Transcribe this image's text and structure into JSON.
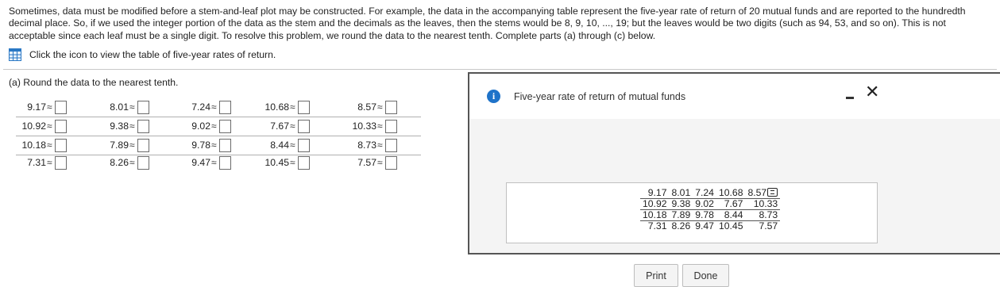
{
  "intro_text": "Sometimes, data must be modified before a stem-and-leaf plot may be constructed. For example, the data in the accompanying table represent the five-year rate of return of 20 mutual funds and are reported to the hundredth decimal place. So, if we used the integer portion of the data as the stem and the decimals as the leaves, then the stems would be 8, 9, 10, ..., 19; but the leaves would be two digits (such as 94, 53, and so on). This is not acceptable since each leaf must be a single digit. To resolve this problem, we round the data to the nearest tenth. Complete parts (a) through (c) below.",
  "view_table_link": "Click the icon to view the table of five-year rates of return.",
  "part_a_label": "(a) Round the data to the nearest tenth.",
  "approx_symbol": "≈",
  "answer_rows": [
    [
      "9.17",
      "8.01",
      "7.24",
      "10.68",
      "8.57"
    ],
    [
      "10.92",
      "9.38",
      "9.02",
      "7.67",
      "10.33"
    ],
    [
      "10.18",
      "7.89",
      "9.78",
      "8.44",
      "8.73"
    ],
    [
      "7.31",
      "8.26",
      "9.47",
      "10.45",
      "7.57"
    ]
  ],
  "popup": {
    "info_glyph": "i",
    "title": "Five-year rate of return of mutual funds",
    "minimize_label": "",
    "close_glyph": "✕",
    "print_label": "Print",
    "done_label": "Done",
    "table_rows": [
      [
        "9.17",
        "8.01",
        "7.24",
        "10.68",
        "8.57"
      ],
      [
        "10.92",
        "9.38",
        "9.02",
        "7.67",
        "10.33"
      ],
      [
        "10.18",
        "7.89",
        "9.78",
        "8.44",
        "8.73"
      ],
      [
        "7.31",
        "8.26",
        "9.47",
        "10.45",
        "7.57"
      ]
    ]
  },
  "colors": {
    "accent": "#1f73c9",
    "border": "#555555",
    "popup_body_bg": "#f4f4f4"
  }
}
